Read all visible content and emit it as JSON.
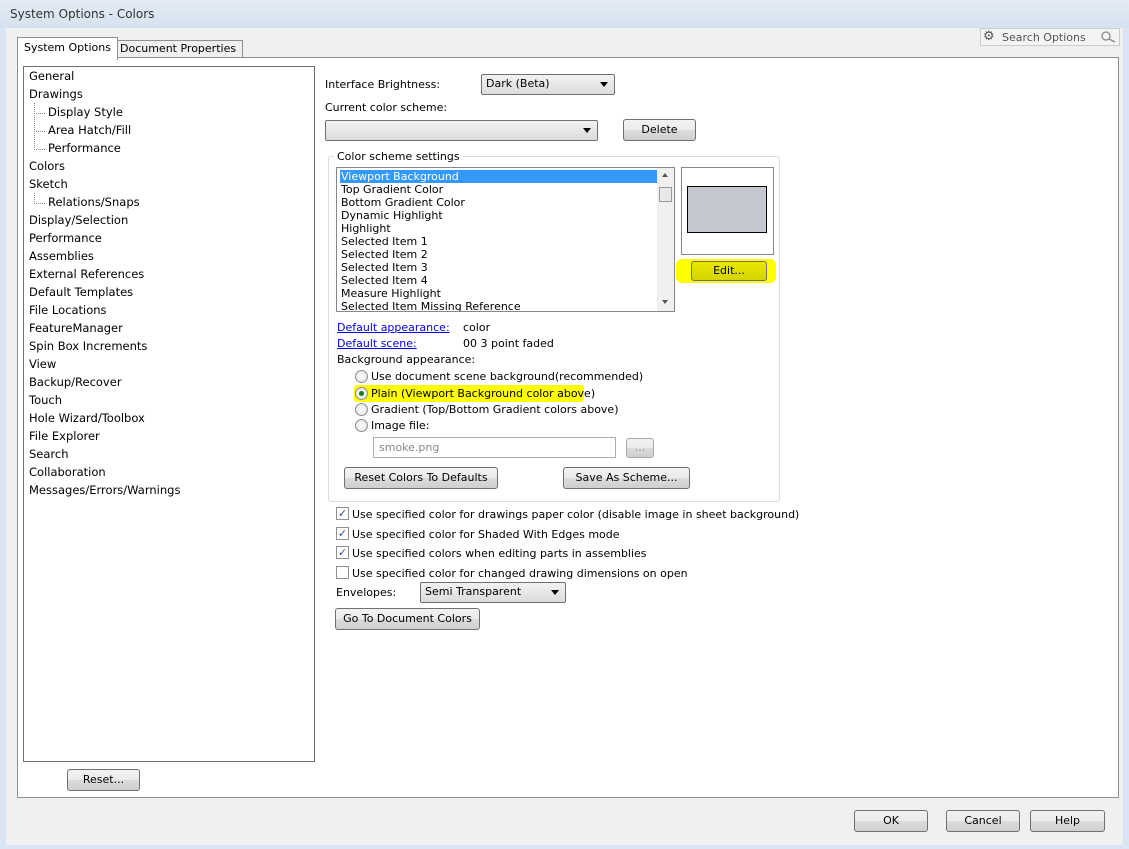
{
  "window": {
    "title": "System Options - Colors"
  },
  "tabs": [
    {
      "label": "System Options",
      "active": true
    },
    {
      "label": "Document Properties",
      "active": false
    }
  ],
  "search": {
    "placeholder": "Search Options",
    "icon": "search-icon",
    "gear_icon": "gear-icon"
  },
  "tree": {
    "items": [
      {
        "label": "General",
        "level": 0
      },
      {
        "label": "Drawings",
        "level": 0
      },
      {
        "label": "Display Style",
        "level": 1
      },
      {
        "label": "Area Hatch/Fill",
        "level": 1
      },
      {
        "label": "Performance",
        "level": 1
      },
      {
        "label": "Colors",
        "level": 0,
        "selected": true
      },
      {
        "label": "Sketch",
        "level": 0
      },
      {
        "label": "Relations/Snaps",
        "level": 1
      },
      {
        "label": "Display/Selection",
        "level": 0
      },
      {
        "label": "Performance",
        "level": 0
      },
      {
        "label": "Assemblies",
        "level": 0
      },
      {
        "label": "External References",
        "level": 0
      },
      {
        "label": "Default Templates",
        "level": 0
      },
      {
        "label": "File Locations",
        "level": 0
      },
      {
        "label": "FeatureManager",
        "level": 0
      },
      {
        "label": "Spin Box Increments",
        "level": 0
      },
      {
        "label": "View",
        "level": 0
      },
      {
        "label": "Backup/Recover",
        "level": 0
      },
      {
        "label": "Touch",
        "level": 0
      },
      {
        "label": "Hole Wizard/Toolbox",
        "level": 0
      },
      {
        "label": "File Explorer",
        "level": 0
      },
      {
        "label": "Search",
        "level": 0
      },
      {
        "label": "Collaboration",
        "level": 0
      },
      {
        "label": "Messages/Errors/Warnings",
        "level": 0
      }
    ]
  },
  "reset_button": "Reset...",
  "main": {
    "brightness_label": "Interface Brightness:",
    "brightness_value": "Dark (Beta)",
    "scheme_label": "Current color scheme:",
    "scheme_value": "",
    "delete_button": "Delete",
    "group_title": "Color scheme settings",
    "color_items": [
      "Viewport Background",
      "Top Gradient Color",
      "Bottom Gradient Color",
      "Dynamic Highlight",
      "Highlight",
      "Selected Item 1",
      "Selected Item 2",
      "Selected Item 3",
      "Selected Item 4",
      "Measure Highlight",
      "Selected Item Missing Reference"
    ],
    "selected_color_item": "Viewport Background",
    "preview_color": "#c5c8d0",
    "edit_button": "Edit...",
    "default_appearance_link": "Default appearance:",
    "default_appearance_value": "color",
    "default_scene_link": "Default scene:",
    "default_scene_value": "00 3 point faded",
    "bg_label": "Background appearance:",
    "bg_options": [
      {
        "label": "Use document scene background(recommended)",
        "checked": false
      },
      {
        "label": "Plain (Viewport Background color above)",
        "checked": true
      },
      {
        "label": "Gradient (Top/Bottom Gradient colors above)",
        "checked": false
      },
      {
        "label": "Image file:",
        "checked": false
      }
    ],
    "image_file_value": "smoke.png",
    "browse_button": "...",
    "reset_colors_button": "Reset Colors To Defaults",
    "save_scheme_button": "Save As Scheme...",
    "checkboxes": [
      {
        "label": "Use specified color for drawings paper color (disable image in sheet background)",
        "checked": true
      },
      {
        "label": "Use specified color for Shaded With Edges mode",
        "checked": true
      },
      {
        "label": "Use specified colors when editing parts in assemblies",
        "checked": true
      },
      {
        "label": "Use specified color for changed drawing dimensions on open",
        "checked": false
      }
    ],
    "envelopes_label": "Envelopes:",
    "envelopes_value": "Semi Transparent",
    "doc_colors_button": "Go To Document Colors",
    "highlight_color": "#ffff00"
  },
  "footer": {
    "ok": "OK",
    "cancel": "Cancel",
    "help": "Help"
  }
}
